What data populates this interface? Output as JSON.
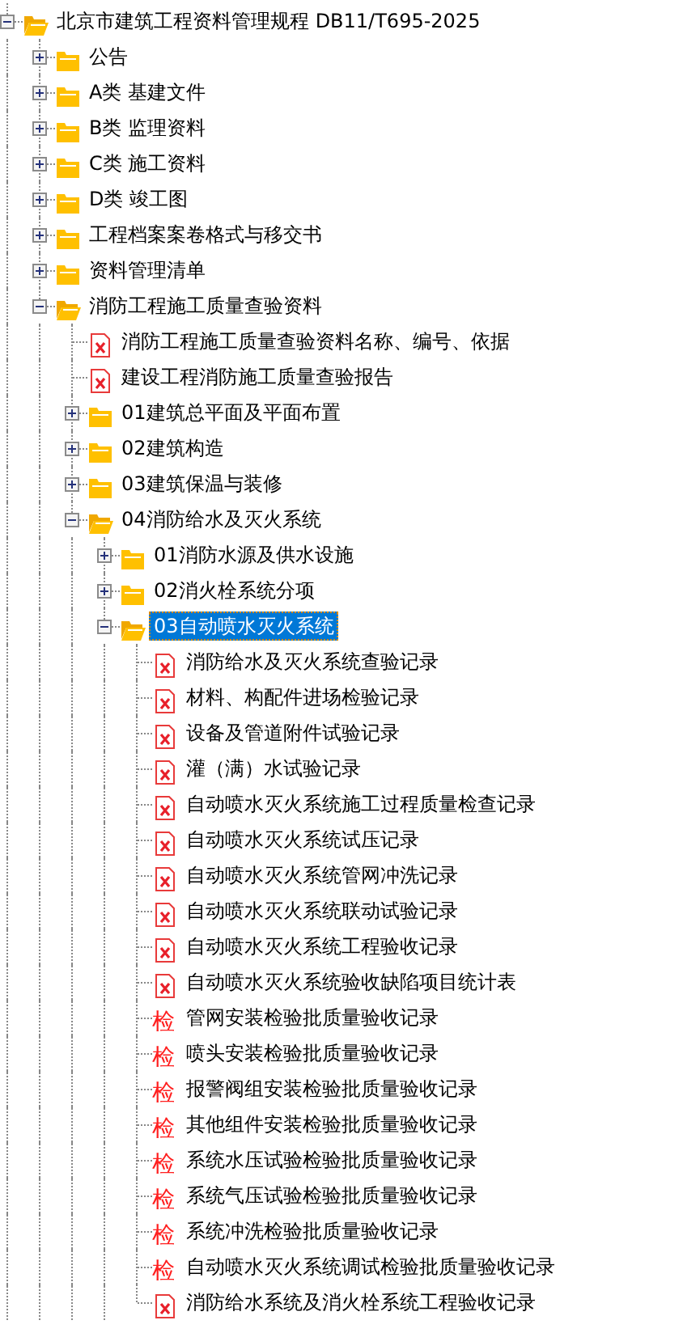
{
  "tree": [
    {
      "kind": "folder",
      "label": "北京市建筑工程资料管理规程 DB11/T695-2025",
      "expanded": true,
      "selected": false,
      "children": [
        {
          "kind": "folder",
          "label": "公告",
          "expanded": false,
          "selected": false
        },
        {
          "kind": "folder",
          "label": "A类 基建文件",
          "expanded": false,
          "selected": false
        },
        {
          "kind": "folder",
          "label": "B类 监理资料",
          "expanded": false,
          "selected": false
        },
        {
          "kind": "folder",
          "label": "C类 施工资料",
          "expanded": false,
          "selected": false
        },
        {
          "kind": "folder",
          "label": "D类 竣工图",
          "expanded": false,
          "selected": false
        },
        {
          "kind": "folder",
          "label": "工程档案案卷格式与移交书",
          "expanded": false,
          "selected": false
        },
        {
          "kind": "folder",
          "label": "资料管理清单",
          "expanded": false,
          "selected": false
        },
        {
          "kind": "folder",
          "label": "消防工程施工质量查验资料",
          "expanded": true,
          "selected": false,
          "children": [
            {
              "kind": "doc",
              "label": "消防工程施工质量查验资料名称、编号、依据",
              "selected": false
            },
            {
              "kind": "doc",
              "label": "建设工程消防施工质量查验报告",
              "selected": false
            },
            {
              "kind": "folder",
              "label": "01建筑总平面及平面布置",
              "expanded": false,
              "selected": false
            },
            {
              "kind": "folder",
              "label": "02建筑构造",
              "expanded": false,
              "selected": false
            },
            {
              "kind": "folder",
              "label": "03建筑保温与装修",
              "expanded": false,
              "selected": false
            },
            {
              "kind": "folder",
              "label": "04消防给水及灭火系统",
              "expanded": true,
              "selected": false,
              "children": [
                {
                  "kind": "folder",
                  "label": "01消防水源及供水设施",
                  "expanded": false,
                  "selected": false
                },
                {
                  "kind": "folder",
                  "label": "02消火栓系统分项",
                  "expanded": false,
                  "selected": false
                },
                {
                  "kind": "folder",
                  "label": "03自动喷水灭火系统",
                  "expanded": true,
                  "selected": true,
                  "children": [
                    {
                      "kind": "doc",
                      "label": "消防给水及灭火系统查验记录",
                      "selected": false
                    },
                    {
                      "kind": "doc",
                      "label": "材料、构配件进场检验记录",
                      "selected": false
                    },
                    {
                      "kind": "doc",
                      "label": "设备及管道附件试验记录",
                      "selected": false
                    },
                    {
                      "kind": "doc",
                      "label": "灌（满）水试验记录",
                      "selected": false
                    },
                    {
                      "kind": "doc",
                      "label": "自动喷水灭火系统施工过程质量检查记录",
                      "selected": false
                    },
                    {
                      "kind": "doc",
                      "label": "自动喷水灭火系统试压记录",
                      "selected": false
                    },
                    {
                      "kind": "doc",
                      "label": "自动喷水灭火系统管网冲洗记录",
                      "selected": false
                    },
                    {
                      "kind": "doc",
                      "label": "自动喷水灭火系统联动试验记录",
                      "selected": false
                    },
                    {
                      "kind": "doc",
                      "label": "自动喷水灭火系统工程验收记录",
                      "selected": false
                    },
                    {
                      "kind": "doc",
                      "label": "自动喷水灭火系统验收缺陷项目统计表",
                      "selected": false
                    },
                    {
                      "kind": "check",
                      "icon_text": "检",
                      "label": "管网安装检验批质量验收记录",
                      "selected": false
                    },
                    {
                      "kind": "check",
                      "icon_text": "检",
                      "label": "喷头安装检验批质量验收记录",
                      "selected": false
                    },
                    {
                      "kind": "check",
                      "icon_text": "检",
                      "label": "报警阀组安装检验批质量验收记录",
                      "selected": false
                    },
                    {
                      "kind": "check",
                      "icon_text": "检",
                      "label": "其他组件安装检验批质量验收记录",
                      "selected": false
                    },
                    {
                      "kind": "check",
                      "icon_text": "检",
                      "label": "系统水压试验检验批质量验收记录",
                      "selected": false
                    },
                    {
                      "kind": "check",
                      "icon_text": "检",
                      "label": "系统气压试验检验批质量验收记录",
                      "selected": false
                    },
                    {
                      "kind": "check",
                      "icon_text": "检",
                      "label": "系统冲洗检验批质量验收记录",
                      "selected": false
                    },
                    {
                      "kind": "check",
                      "icon_text": "检",
                      "label": "自动喷水灭火系统调试检验批质量验收记录",
                      "selected": false
                    },
                    {
                      "kind": "doc",
                      "label": "消防给水系统及消火栓系统工程验收记录",
                      "selected": false
                    }
                  ]
                }
              ]
            }
          ]
        }
      ]
    }
  ]
}
